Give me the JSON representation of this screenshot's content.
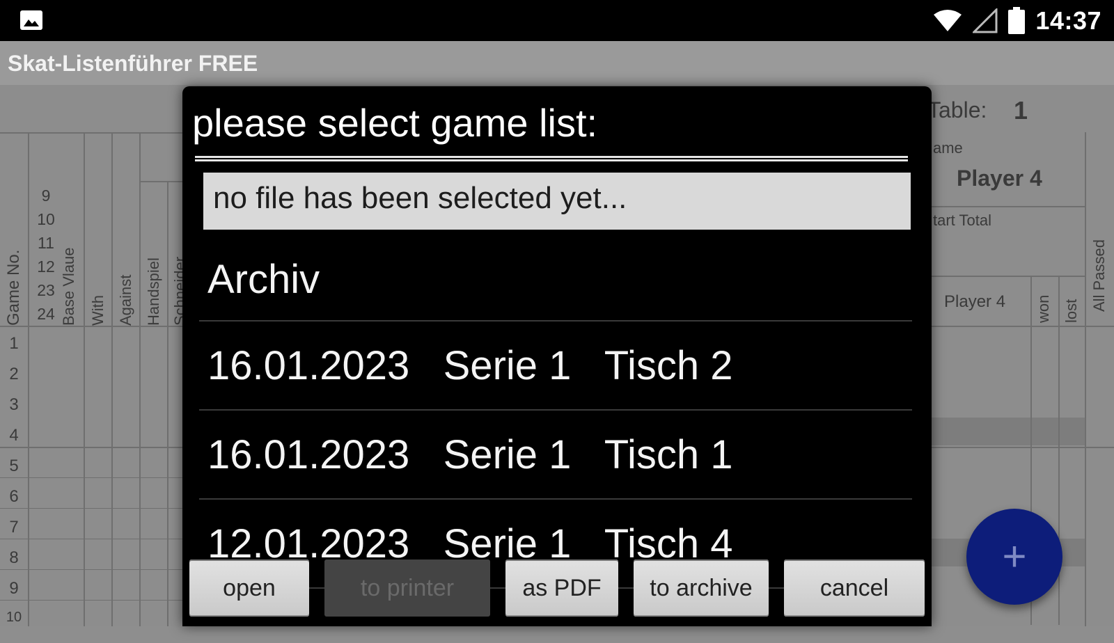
{
  "statusbar": {
    "time": "14:37",
    "icons": [
      "image-notification-icon",
      "wifi-icon",
      "cell-signal-icon",
      "battery-icon"
    ]
  },
  "app": {
    "title": "Skat-Listenführer FREE"
  },
  "sheet": {
    "table_label": "Table:",
    "table_number": "1",
    "name_label": "ame",
    "player_name": "Player 4",
    "start_total_label": "tart Total",
    "player_col_label": "Player 4",
    "won_label": "won",
    "lost_label": "lost",
    "all_passed_label": "All Passed",
    "col_game_no": "Game No.",
    "col_base_value": "Base Vlaue",
    "col_with": "With",
    "col_against": "Against",
    "col_handspiel": "Handspiel",
    "col_schneider": "Schneider",
    "base_values": [
      "9",
      "10",
      "11",
      "12",
      "23",
      "24"
    ],
    "row_numbers": [
      "1",
      "2",
      "3",
      "4",
      "5",
      "6",
      "7",
      "8",
      "9",
      "10"
    ]
  },
  "dialog": {
    "title": "please select game list:",
    "file_field_text": "no file has been selected yet...",
    "items": [
      {
        "label": "Archiv"
      },
      {
        "label": "16.01.2023   Serie 1   Tisch 2"
      },
      {
        "label": "16.01.2023   Serie 1   Tisch 1"
      },
      {
        "label": "12.01.2023   Serie 1   Tisch 4"
      }
    ],
    "buttons": {
      "open": "open",
      "to_printer": "to printer",
      "as_pdf": "as PDF",
      "to_archive": "to archive",
      "cancel": "cancel"
    }
  },
  "fab": {
    "symbol": "+",
    "color": "#0d1d7a"
  }
}
